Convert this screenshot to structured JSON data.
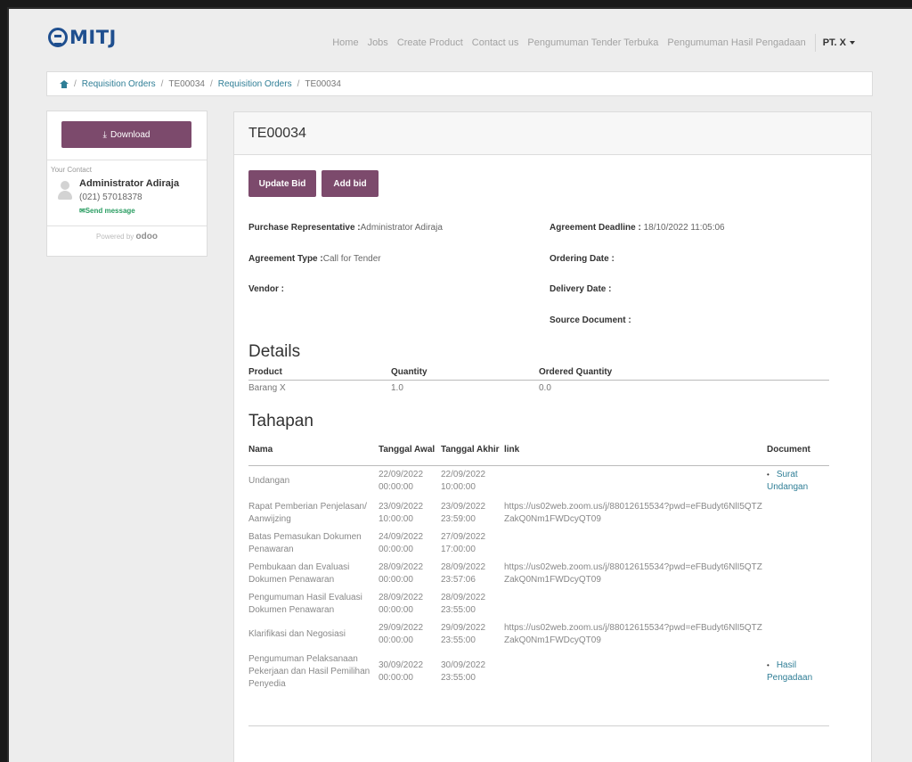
{
  "navbar": {
    "logo_text": "MITJ",
    "links": [
      "Home",
      "Jobs",
      "Create Product",
      "Contact us",
      "Pengumuman Tender Terbuka",
      "Pengumuman Hasil Pengadaan"
    ],
    "user": "PT. X"
  },
  "breadcrumb": {
    "items": [
      "Requisition Orders",
      "TE00034",
      "Requisition Orders",
      "TE00034"
    ]
  },
  "sidebar": {
    "download_label": "Download",
    "contact_label": "Your Contact",
    "contact_name": "Administrator Adiraja",
    "contact_phone": "(021) 57018378",
    "send_message": "Send message",
    "powered_by": "Powered by",
    "powered_brand": "odoo"
  },
  "main": {
    "title": "TE00034",
    "update_bid_label": "Update Bid",
    "add_bid_label": "Add bid",
    "fields": {
      "purchase_rep_label": "Purchase Representative :",
      "purchase_rep_value": "Administrator Adiraja",
      "agreement_type_label": "Agreement Type :",
      "agreement_type_value": "Call for Tender",
      "vendor_label": "Vendor :",
      "agreement_deadline_label": "Agreement Deadline :",
      "agreement_deadline_value": "18/10/2022 11:05:06",
      "ordering_date_label": "Ordering Date :",
      "delivery_date_label": "Delivery Date :",
      "source_document_label": "Source Document :"
    },
    "details_title": "Details",
    "details_headers": [
      "Product",
      "Quantity",
      "Ordered Quantity"
    ],
    "details_rows": [
      [
        "Barang X",
        "1.0",
        "0.0"
      ]
    ],
    "tahapan_title": "Tahapan",
    "tahapan_headers": [
      "Nama",
      "Tanggal Awal",
      "Tanggal Akhir",
      "link",
      "Document"
    ],
    "tahapan_rows": [
      {
        "nama": "Undangan",
        "awal": "22/09/2022 00:00:00",
        "akhir": "22/09/2022 10:00:00",
        "link": "",
        "doc": "Surat Undangan"
      },
      {
        "nama": "Rapat Pemberian Penjelasan/ Aanwijzing",
        "awal": "23/09/2022 10:00:00",
        "akhir": "23/09/2022 23:59:00",
        "link": "https://us02web.zoom.us/j/88012615534?pwd=eFBudyt6NlI5QTZZakQ0Nm1FWDcyQT09",
        "doc": ""
      },
      {
        "nama": "Batas Pemasukan Dokumen Penawaran",
        "awal": "24/09/2022 00:00:00",
        "akhir": "27/09/2022 17:00:00",
        "link": "",
        "doc": ""
      },
      {
        "nama": "Pembukaan dan Evaluasi Dokumen Penawaran",
        "awal": "28/09/2022 00:00:00",
        "akhir": "28/09/2022 23:57:06",
        "link": "https://us02web.zoom.us/j/88012615534?pwd=eFBudyt6NlI5QTZZakQ0Nm1FWDcyQT09",
        "doc": ""
      },
      {
        "nama": "Pengumuman Hasil Evaluasi Dokumen Penawaran",
        "awal": "28/09/2022 00:00:00",
        "akhir": "28/09/2022 23:55:00",
        "link": "",
        "doc": ""
      },
      {
        "nama": "Klarifikasi dan Negosiasi",
        "awal": "29/09/2022 00:00:00",
        "akhir": "29/09/2022 23:55:00",
        "link": "https://us02web.zoom.us/j/88012615534?pwd=eFBudyt6NlI5QTZZakQ0Nm1FWDcyQT09",
        "doc": ""
      },
      {
        "nama": "Pengumuman Pelaksanaan Pekerjaan dan Hasil Pemilihan Penyedia",
        "awal": "30/09/2022 00:00:00",
        "akhir": "30/09/2022 23:55:00",
        "link": "",
        "doc": "Hasil Pengadaan"
      }
    ]
  }
}
